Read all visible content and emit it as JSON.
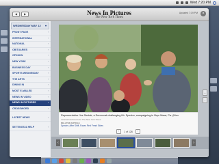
{
  "menubar": {
    "clock": "Wed 7:20 PM"
  },
  "app": {
    "title": "News In Pictures",
    "subtitle": "The New York Times",
    "updated": "Updated 7:19 PM",
    "nav_back": "◀",
    "nav_fwd": "▶",
    "sections": [
      {
        "label": "WEDNESDAY MAY 12",
        "type": "head"
      },
      {
        "label": "FRONT PAGE"
      },
      {
        "label": "INTERNATIONAL"
      },
      {
        "label": "NATIONAL"
      },
      {
        "label": "OBITUARIES"
      },
      {
        "label": "OPINION"
      },
      {
        "label": "NEW YORK"
      },
      {
        "label": "BUSINESS DAY"
      },
      {
        "label": "SPORTS WEDNESDAY"
      },
      {
        "label": "THE ARTS"
      },
      {
        "label": "DINING IN"
      },
      {
        "label": "MOST E-MAILED"
      },
      {
        "label": "NEWS IN VIDEO"
      },
      {
        "label": "NEWS IN PICTURES",
        "active": true
      },
      {
        "label": "CROSSWORD"
      },
      {
        "label": "LATEST NEWS",
        "sep": true
      },
      {
        "label": "SETTINGS & HELP",
        "sep": true
      }
    ]
  },
  "photo": {
    "caption": "Representative Joe Sestak, a Democrat challenging Mr. Specter, campaigning in Bryn Mawr, Pa. (Mon",
    "credit": "Jessica Kourkounis for The New York Times",
    "related_label": "RELATED ARTICLE",
    "related_text": "Specter, After Shift, Faces First Fresh Sides",
    "pager": "1 of 126"
  },
  "colors": {
    "nav_active": "#24417d",
    "nav_text": "#2b4f96"
  },
  "thumbs": [
    {
      "color": "#6a7f55"
    },
    {
      "color": "#3d4e63"
    },
    {
      "color": "#a78f6f"
    },
    {
      "color": "#5b6e4b",
      "selected": true
    },
    {
      "color": "#7f8a98"
    },
    {
      "color": "#4a5c3d"
    },
    {
      "color": "#8c7a63"
    }
  ]
}
